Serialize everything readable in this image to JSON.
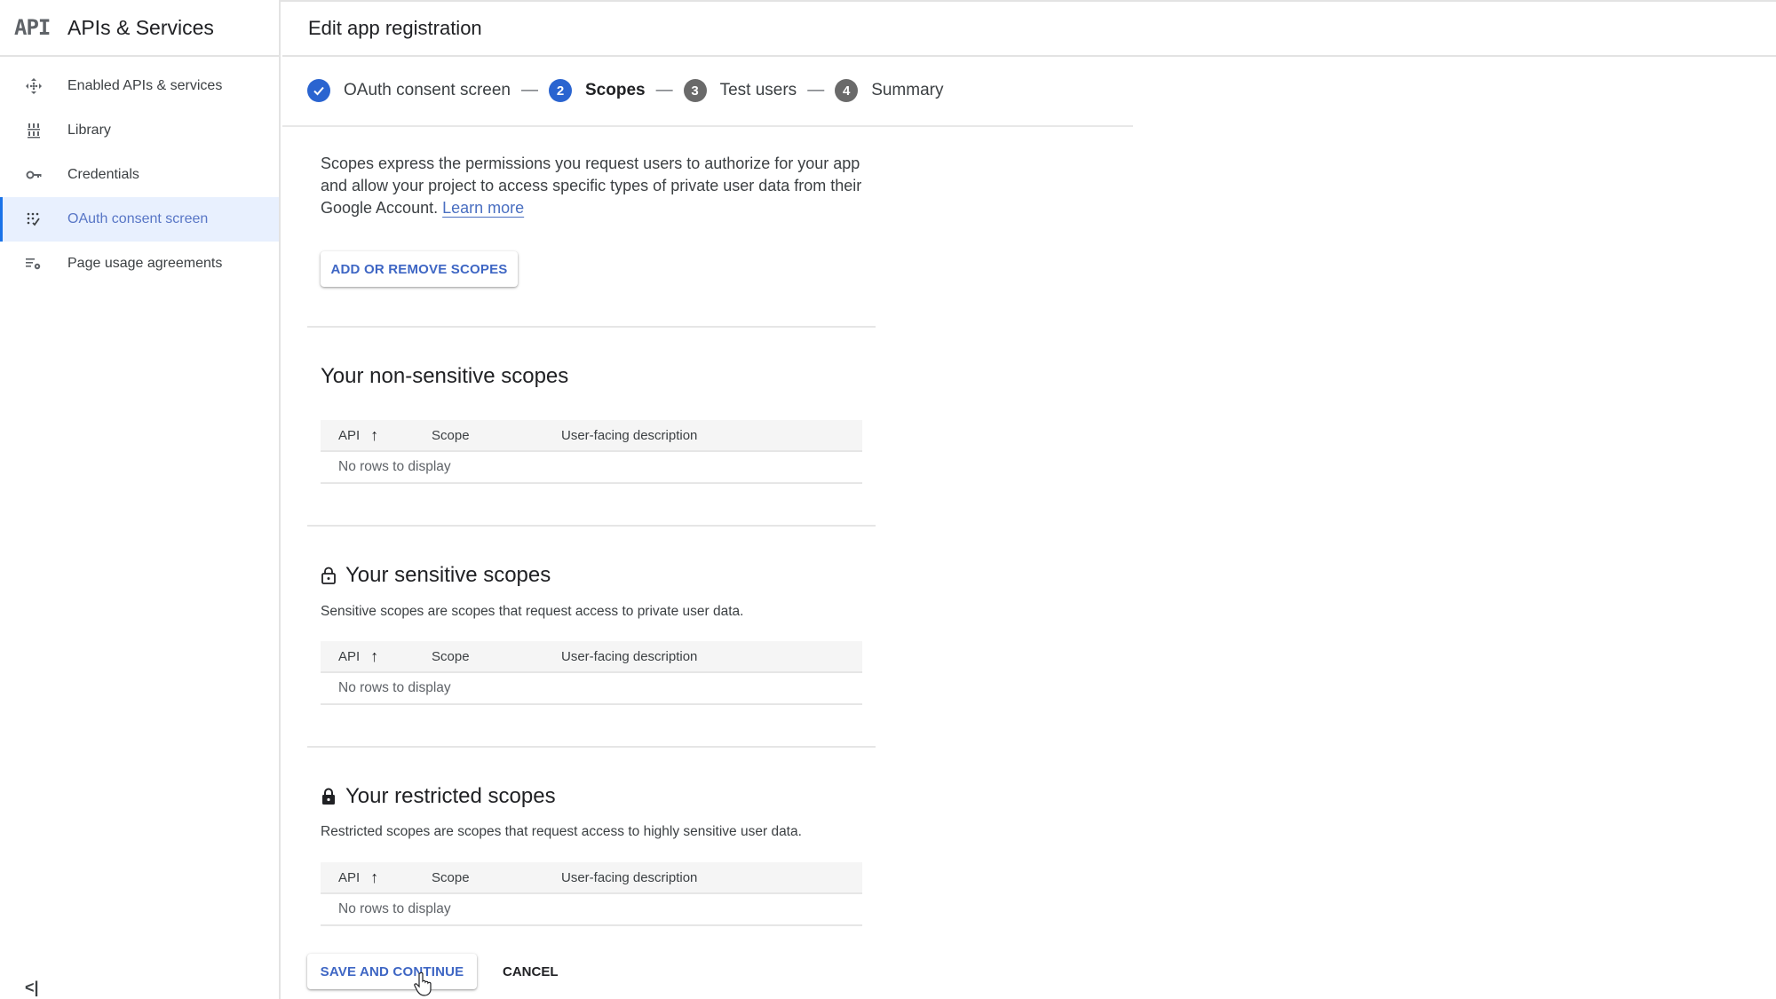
{
  "sidebar": {
    "logo": "API",
    "title": "APIs & Services",
    "items": [
      {
        "label": "Enabled APIs & services",
        "icon": "enabled-apis-icon",
        "active": false
      },
      {
        "label": "Library",
        "icon": "library-icon",
        "active": false
      },
      {
        "label": "Credentials",
        "icon": "key-icon",
        "active": false
      },
      {
        "label": "OAuth consent screen",
        "icon": "oauth-consent-icon",
        "active": true
      },
      {
        "label": "Page usage agreements",
        "icon": "settings-list-icon",
        "active": false
      }
    ],
    "collapse_label": "<|"
  },
  "header": {
    "title": "Edit app registration"
  },
  "stepper": {
    "steps": [
      {
        "number": "1",
        "label": "OAuth consent screen",
        "state": "done"
      },
      {
        "number": "2",
        "label": "Scopes",
        "state": "current"
      },
      {
        "number": "3",
        "label": "Test users",
        "state": "todo"
      },
      {
        "number": "4",
        "label": "Summary",
        "state": "todo"
      }
    ],
    "separator": "—"
  },
  "intro": {
    "text": "Scopes express the permissions you request users to authorize for your app and allow your project to access specific types of private user data from their Google Account.",
    "link": "Learn more"
  },
  "add_scopes_button": "ADD OR REMOVE SCOPES",
  "table_columns": {
    "api": "API",
    "api_sort": "↑",
    "scope": "Scope",
    "description": "User-facing description"
  },
  "sections": {
    "non_sensitive": {
      "title": "Your non-sensitive scopes",
      "empty": "No rows to display"
    },
    "sensitive": {
      "title": "Your sensitive scopes",
      "description": "Sensitive scopes are scopes that request access to private user data.",
      "empty": "No rows to display"
    },
    "restricted": {
      "title": "Your restricted scopes",
      "description": "Restricted scopes are scopes that request access to highly sensitive user data.",
      "empty": "No rows to display"
    }
  },
  "actions": {
    "save": "SAVE AND CONTINUE",
    "cancel": "CANCEL"
  },
  "colors": {
    "accent": "#2a64d0",
    "link": "#4a6fc1",
    "active_nav_bg": "#e8f0fe"
  }
}
